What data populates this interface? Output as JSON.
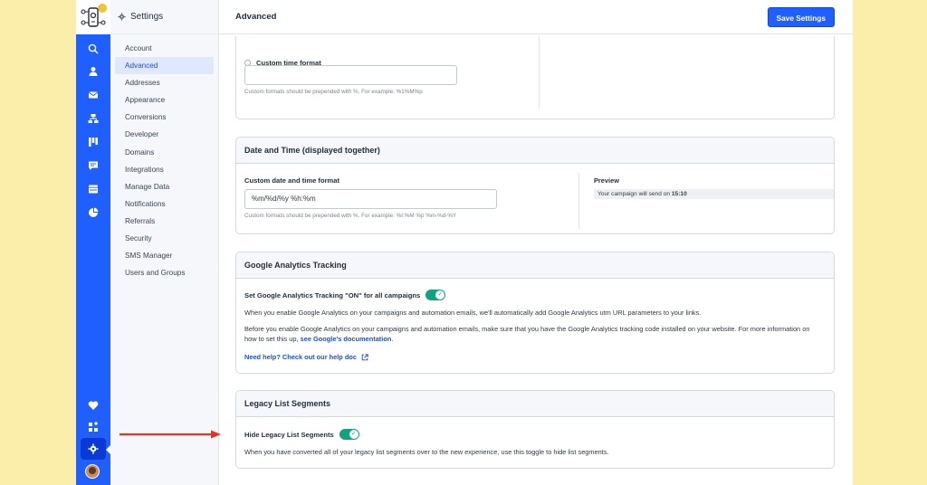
{
  "sidebar": {
    "title": "Settings",
    "items": [
      {
        "label": "Account"
      },
      {
        "label": "Advanced"
      },
      {
        "label": "Addresses"
      },
      {
        "label": "Appearance"
      },
      {
        "label": "Conversions"
      },
      {
        "label": "Developer"
      },
      {
        "label": "Domains"
      },
      {
        "label": "Integrations"
      },
      {
        "label": "Manage Data"
      },
      {
        "label": "Notifications"
      },
      {
        "label": "Referrals"
      },
      {
        "label": "Security"
      },
      {
        "label": "SMS Manager"
      },
      {
        "label": "Users and Groups"
      }
    ],
    "active": "Advanced"
  },
  "rail": {
    "icons": [
      "search-icon",
      "contacts-icon",
      "email-icon",
      "automations-icon",
      "pipelines-icon",
      "conversations-icon",
      "website-icon",
      "reports-icon",
      "heart-icon",
      "apps-icon",
      "settings-icon"
    ]
  },
  "header": {
    "title": "Advanced",
    "save_label": "Save Settings"
  },
  "time_card": {
    "radio_label": "Custom time format",
    "input_value": "",
    "hint": "Custom formats should be prepended with %. For example: %1%M%p"
  },
  "datetime_card": {
    "title": "Date and Time (displayed together)",
    "field_label": "Custom date and time format",
    "input_value": "%m/%d/%y %h:%m",
    "hint": "Custom formats should be prepended with %. For example: %I:%M %p %m-%d-%Y",
    "preview_label": "Preview",
    "preview_prefix": "Your campaign will send on ",
    "preview_value": "15:10"
  },
  "ga_card": {
    "title": "Google Analytics Tracking",
    "toggle_label": "Set Google Analytics Tracking \"ON\" for all campaigns",
    "toggle_on": true,
    "para1": "When you enable Google Analytics on your campaigns and automation emails, we'll automatically add Google Analytics utm URL parameters to your links.",
    "para2_a": "Before you enable Google Analytics on your campaigns and automation emails, make sure that you have the Google Analytics tracking code installed on your website. For more information on how to set this up, ",
    "para2_link": "see Google's documentation",
    "para2_b": ".",
    "help_link": "Need help? Check out our help doc"
  },
  "legacy_card": {
    "title": "Legacy List Segments",
    "toggle_label": "Hide Legacy List Segments",
    "toggle_on": true,
    "desc": "When you have converted all of your legacy list segments over to the new experience, use this toggle to hide list segments."
  },
  "colors": {
    "accent": "#1f5fff",
    "toggle_on": "#0fa37f",
    "annotation_arrow": "#e8321e",
    "background": "#fbeeaa"
  }
}
